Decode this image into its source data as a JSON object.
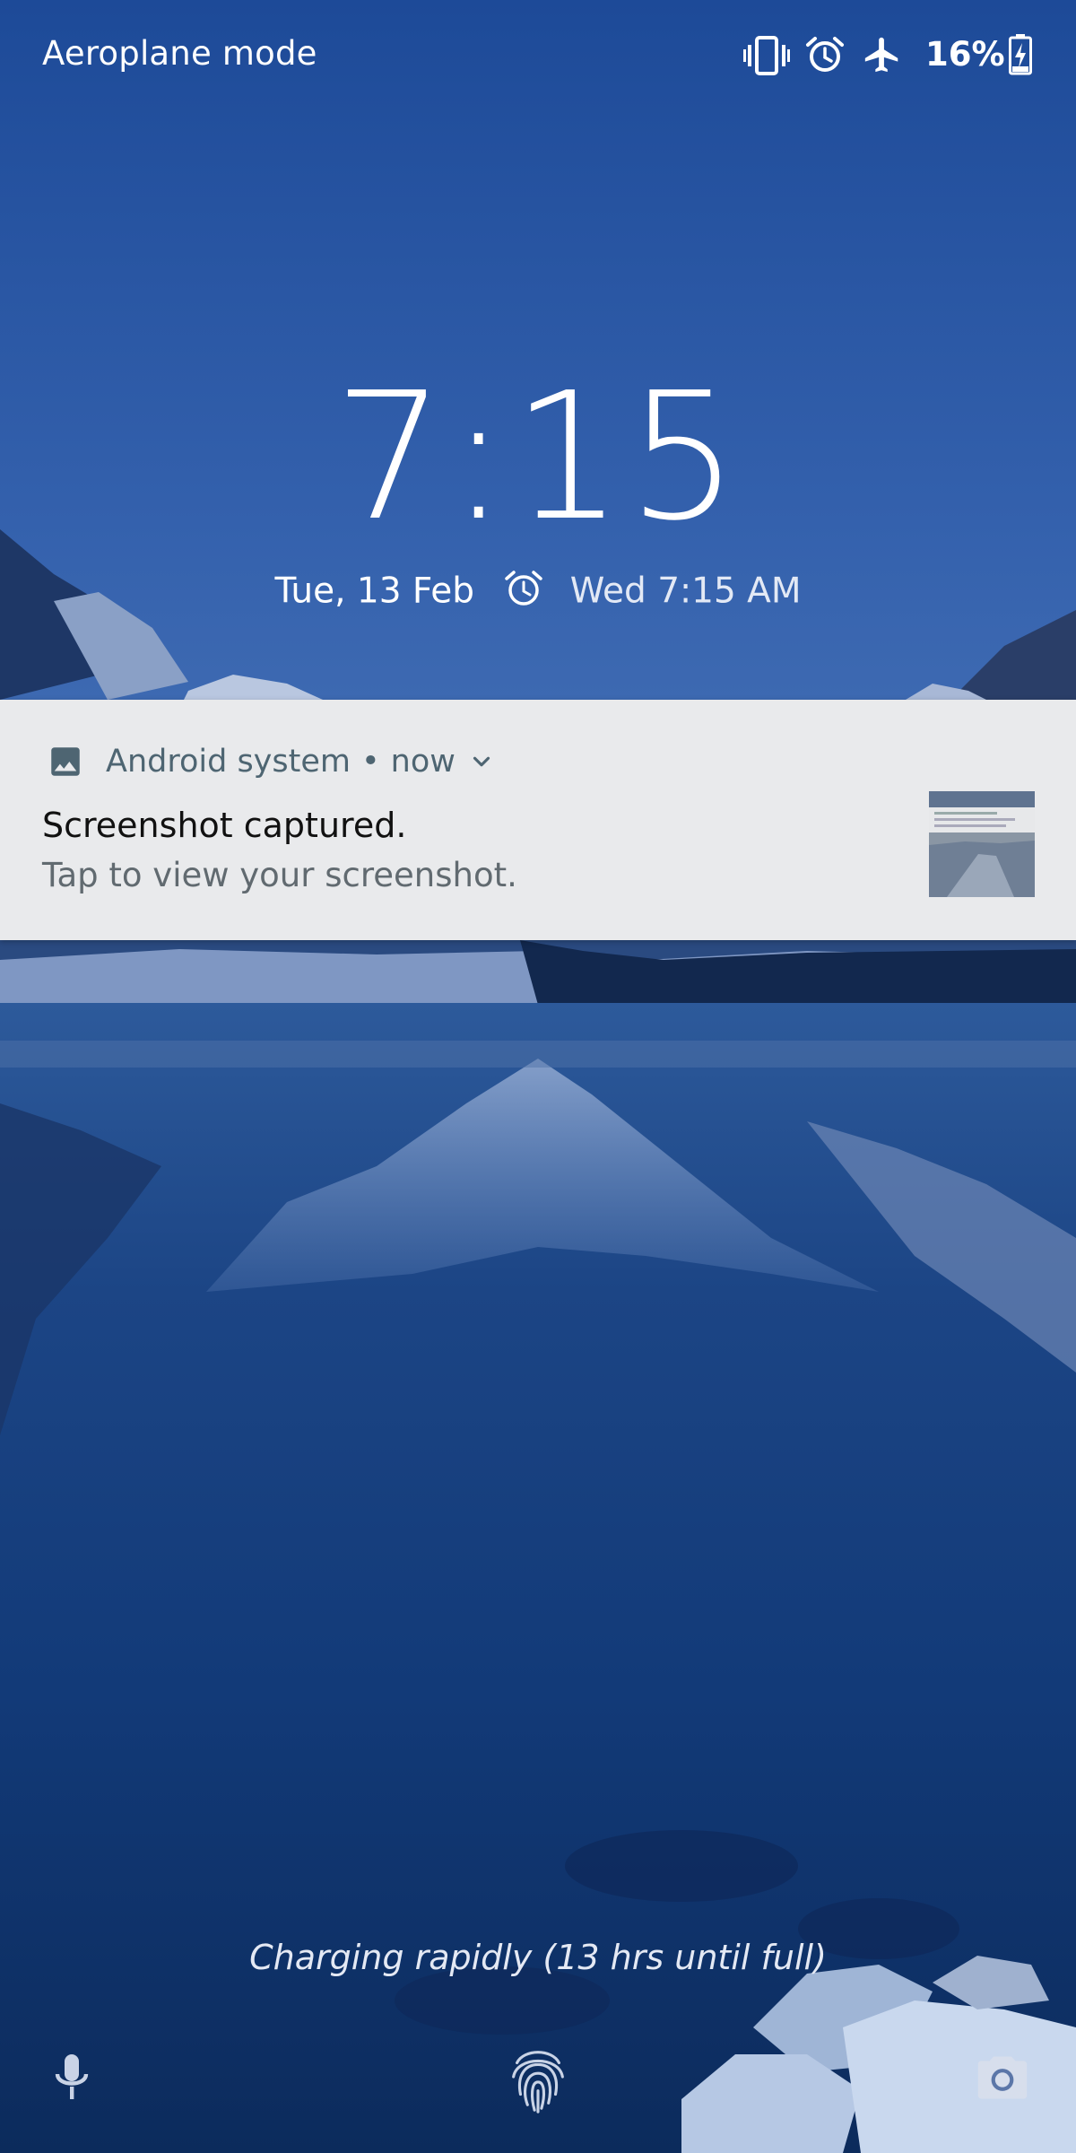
{
  "status_bar": {
    "carrier_text": "Aeroplane mode",
    "icons": [
      "vibrate-icon",
      "alarm-icon",
      "airplane-icon",
      "battery-charging-icon"
    ],
    "battery_percent": "16%"
  },
  "lockscreen": {
    "time": "7:15",
    "date": "Tue, 13 Feb",
    "next_alarm": "Wed 7:15 AM"
  },
  "notification": {
    "app_name": "Android system",
    "separator": "•",
    "time": "now",
    "title": "Screenshot captured.",
    "text": "Tap to view your screenshot.",
    "icon": "gallery-icon"
  },
  "bottom": {
    "charging_text": "Charging rapidly (13 hrs until full)",
    "left_icon": "microphone-icon",
    "center_icon": "fingerprint-icon",
    "right_icon": "camera-icon"
  },
  "colors": {
    "notification_bg": "#e9eaec",
    "notification_header": "#4e6572",
    "wallpaper_sky": "#2c5aa6",
    "wallpaper_water": "#0f2d66"
  }
}
